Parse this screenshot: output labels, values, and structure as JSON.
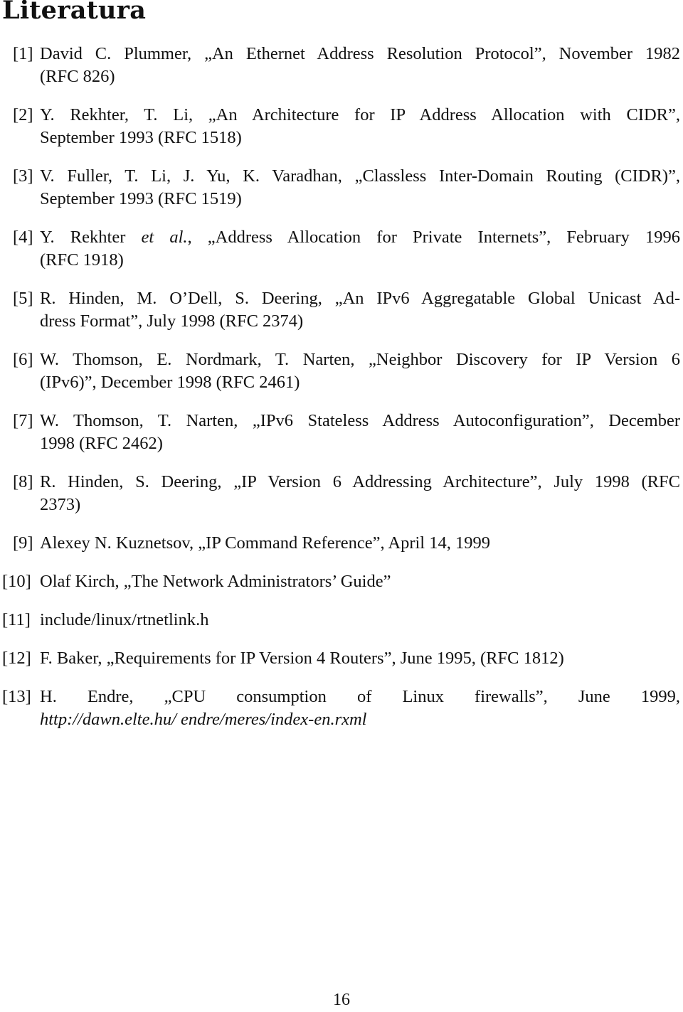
{
  "document": {
    "title": "Literatura",
    "page_number": "16",
    "references": [
      {
        "num": "[1]",
        "lines": [
          "David C. Plummer, „An Ethernet Address Resolution Protocol”, November 1982",
          "(RFC 826)"
        ]
      },
      {
        "num": "[2]",
        "lines": [
          "Y. Rekhter, T. Li, „An Architecture for IP Address Allocation with CIDR”,",
          "September 1993 (RFC 1518)"
        ]
      },
      {
        "num": "[3]",
        "lines": [
          "V. Fuller, T. Li, J. Yu, K. Varadhan, „Classless Inter-Domain Routing (CIDR)”,",
          "September 1993 (RFC 1519)"
        ]
      },
      {
        "num": "[4]",
        "pre": "Y. Rekhter ",
        "italic": "et al.",
        "post": ", „Address Allocation for Private Internets”, February 1996",
        "line2": "(RFC 1918)"
      },
      {
        "num": "[5]",
        "lines": [
          "R. Hinden, M. O’Dell, S. Deering, „An IPv6 Aggregatable Global Unicast Ad-",
          "dress Format”, July 1998 (RFC 2374)"
        ]
      },
      {
        "num": "[6]",
        "lines": [
          "W. Thomson, E. Nordmark, T. Narten, „Neighbor Discovery for IP Version 6",
          "(IPv6)”, December 1998 (RFC 2461)"
        ]
      },
      {
        "num": "[7]",
        "lines": [
          "W. Thomson, T. Narten, „IPv6 Stateless Address Autoconfiguration”, December",
          "1998 (RFC 2462)"
        ]
      },
      {
        "num": "[8]",
        "lines": [
          "R. Hinden, S. Deering, „IP Version 6 Addressing Architecture”, July 1998 (RFC",
          "2373)"
        ]
      },
      {
        "num": "[9]",
        "lines": [
          "Alexey N. Kuznetsov, „IP Command Reference”, April 14, 1999"
        ]
      },
      {
        "num": "[10]",
        "lines": [
          "Olaf Kirch, „The Network Administrators’ Guide”"
        ]
      },
      {
        "num": "[11]",
        "lines": [
          "include/linux/rtnetlink.h"
        ]
      },
      {
        "num": "[12]",
        "lines": [
          "F. Baker, „Requirements for IP Version 4 Routers”, June 1995, (RFC 1812)"
        ]
      },
      {
        "num": "[13]",
        "lines": [
          "H. Endre, „CPU consumption of Linux firewalls”, June 1999,"
        ],
        "url": "http://dawn.elte.hu/ endre/meres/index-en.rxml"
      }
    ]
  }
}
